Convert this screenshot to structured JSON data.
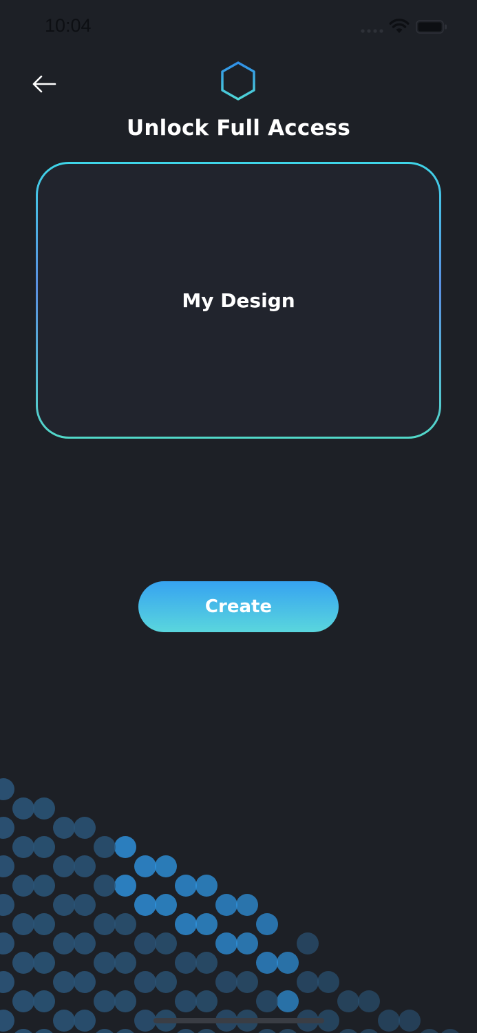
{
  "status_bar": {
    "time": "10:04",
    "icons": [
      "signal-icon",
      "wifi-icon",
      "battery-icon"
    ]
  },
  "header": {
    "back_icon": "arrow-left-icon",
    "logo_icon": "hexagon-logo-icon",
    "title": "Unlock Full Access"
  },
  "design_card": {
    "label": "My Design"
  },
  "actions": {
    "create_label": "Create"
  },
  "colors": {
    "background": "#1d2026",
    "card_background": "#21242d",
    "accent_blue": "#36a3f1",
    "accent_teal": "#5ad6dd",
    "dot_dark": "#2b5578",
    "dot_bright": "#2f95e2"
  }
}
